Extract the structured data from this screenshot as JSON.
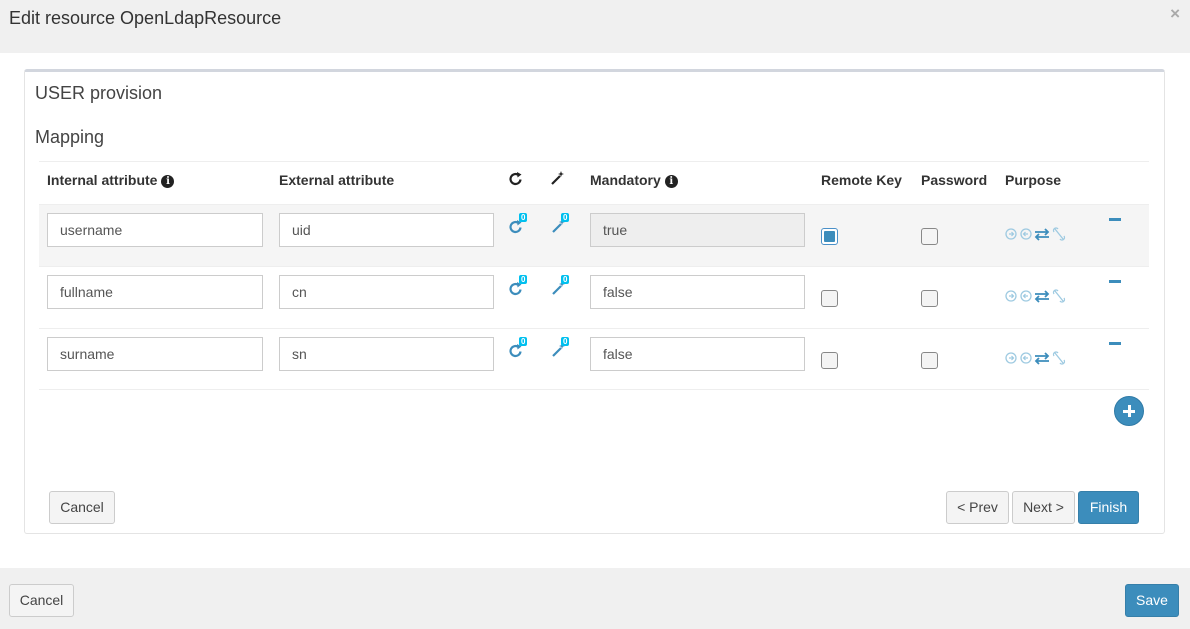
{
  "modal": {
    "title": "Edit resource OpenLdapResource",
    "close_label": "×"
  },
  "wizard": {
    "section_title": "USER provision",
    "mapping_title": "Mapping",
    "columns": {
      "internal": "Internal attribute",
      "external": "External attribute",
      "mandatory": "Mandatory",
      "remote_key": "Remote Key",
      "password": "Password",
      "purpose": "Purpose"
    },
    "rows": [
      {
        "internal": "username",
        "external": "uid",
        "transformer_count": "0",
        "job_count": "0",
        "mandatory": "true",
        "remote_key": true,
        "password": false
      },
      {
        "internal": "fullname",
        "external": "cn",
        "transformer_count": "0",
        "job_count": "0",
        "mandatory": "false",
        "remote_key": false,
        "password": false
      },
      {
        "internal": "surname",
        "external": "sn",
        "transformer_count": "0",
        "job_count": "0",
        "mandatory": "false",
        "remote_key": false,
        "password": false
      }
    ],
    "buttons": {
      "cancel": "Cancel",
      "prev": "< Prev",
      "next": "Next >",
      "finish": "Finish"
    }
  },
  "footer": {
    "cancel": "Cancel",
    "save": "Save"
  },
  "colors": {
    "accent": "#3c8dbc",
    "badge": "#00c0ef",
    "header_bg": "#f0f0f0"
  }
}
